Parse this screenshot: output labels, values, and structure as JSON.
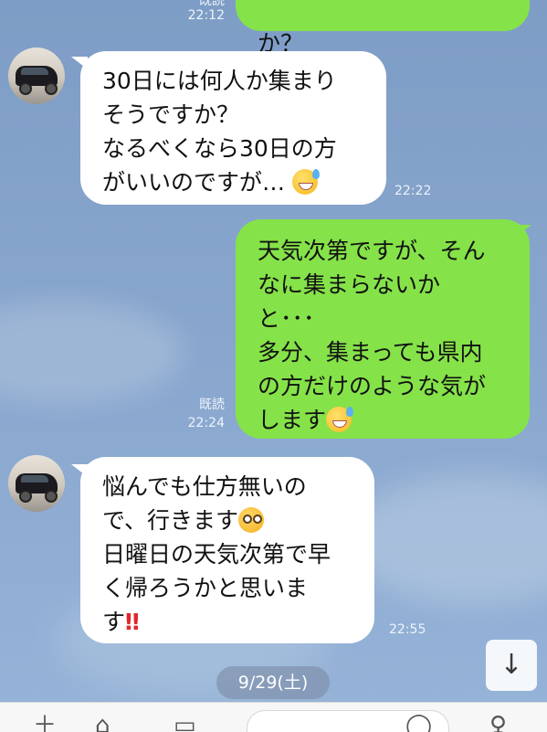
{
  "messages": [
    {
      "id": "m0",
      "direction": "out",
      "text": "か？",
      "read_label": "既読",
      "time": "22:12"
    },
    {
      "id": "m1",
      "direction": "in",
      "text_main": "30日には何人か集まり\nそうですか？\nなるべくなら30日の方\nがいいのですが…",
      "emoji": "sweat-smile-emoji",
      "time": "22:22"
    },
    {
      "id": "m2",
      "direction": "out",
      "text_main": "天気次第ですが、そん\nなに集まらないか\nと･･･\n多分、集まっても県内\nの方だけのような気が\nします",
      "emoji": "sweat-smile-emoji",
      "read_label": "既読",
      "time": "22:24"
    },
    {
      "id": "m3",
      "direction": "in",
      "text_main": "悩んでも仕方無いの\nで、行きます",
      "emoji": "flushed-emoji",
      "text_after": "\n日曜日の天気次第で早\nく帰ろうかと思いま\nす",
      "emoji2": "‼",
      "time": "22:55"
    }
  ],
  "date_separator": "9/29(土)",
  "scroll_button_icon": "arrow-down-icon",
  "colors": {
    "outgoing_bubble": "#85e249",
    "incoming_bubble": "#ffffff",
    "background": "#88a6cd"
  }
}
